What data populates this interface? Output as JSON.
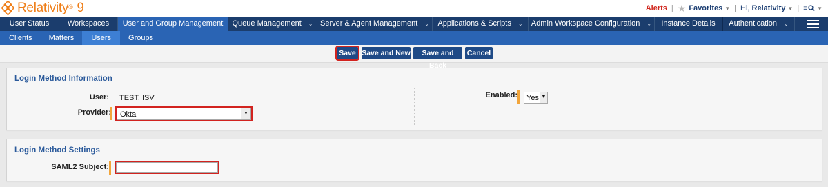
{
  "header": {
    "brand_name": "Relativity",
    "brand_mark": "®",
    "brand_version": "9",
    "alerts_label": "Alerts",
    "favorites_label": "Favorites",
    "greeting_prefix": "Hi, ",
    "user_name": "Relativity",
    "search_icon": "search-icon"
  },
  "main_nav": {
    "tabs": [
      {
        "label": "User Status",
        "dropdown": false,
        "active": false
      },
      {
        "label": "Workspaces",
        "dropdown": false,
        "active": false
      },
      {
        "label": "User and Group Management",
        "dropdown": false,
        "active": true
      },
      {
        "label": "Queue Management",
        "dropdown": true,
        "active": false
      },
      {
        "label": "Server & Agent Management",
        "dropdown": true,
        "active": false
      },
      {
        "label": "Applications & Scripts",
        "dropdown": true,
        "active": false
      },
      {
        "label": "Admin Workspace Configuration",
        "dropdown": true,
        "active": false
      },
      {
        "label": "Instance Details",
        "dropdown": false,
        "active": false
      },
      {
        "label": "Authentication",
        "dropdown": true,
        "active": false
      }
    ]
  },
  "sub_nav": {
    "tabs": [
      {
        "label": "Clients",
        "active": false
      },
      {
        "label": "Matters",
        "active": false
      },
      {
        "label": "Users",
        "active": true
      },
      {
        "label": "Groups",
        "active": false
      }
    ]
  },
  "actions": {
    "save": "Save",
    "save_and_new": "Save and New",
    "save_and_back": "Save and Back",
    "cancel": "Cancel"
  },
  "login_info": {
    "title": "Login Method Information",
    "user_label": "User:",
    "user_value": "TEST, ISV",
    "provider_label": "Provider:",
    "provider_value": "Okta",
    "enabled_label": "Enabled:",
    "enabled_value": "Yes"
  },
  "login_settings": {
    "title": "Login Method Settings",
    "saml_label": "SAML2 Subject:",
    "saml_value": ""
  },
  "colors": {
    "nav_dark": "#1b3d6d",
    "nav_active": "#2a64b4",
    "brand_orange": "#ef7f1a",
    "required_bar": "#f2a53b",
    "highlight_red": "#d2231f"
  }
}
